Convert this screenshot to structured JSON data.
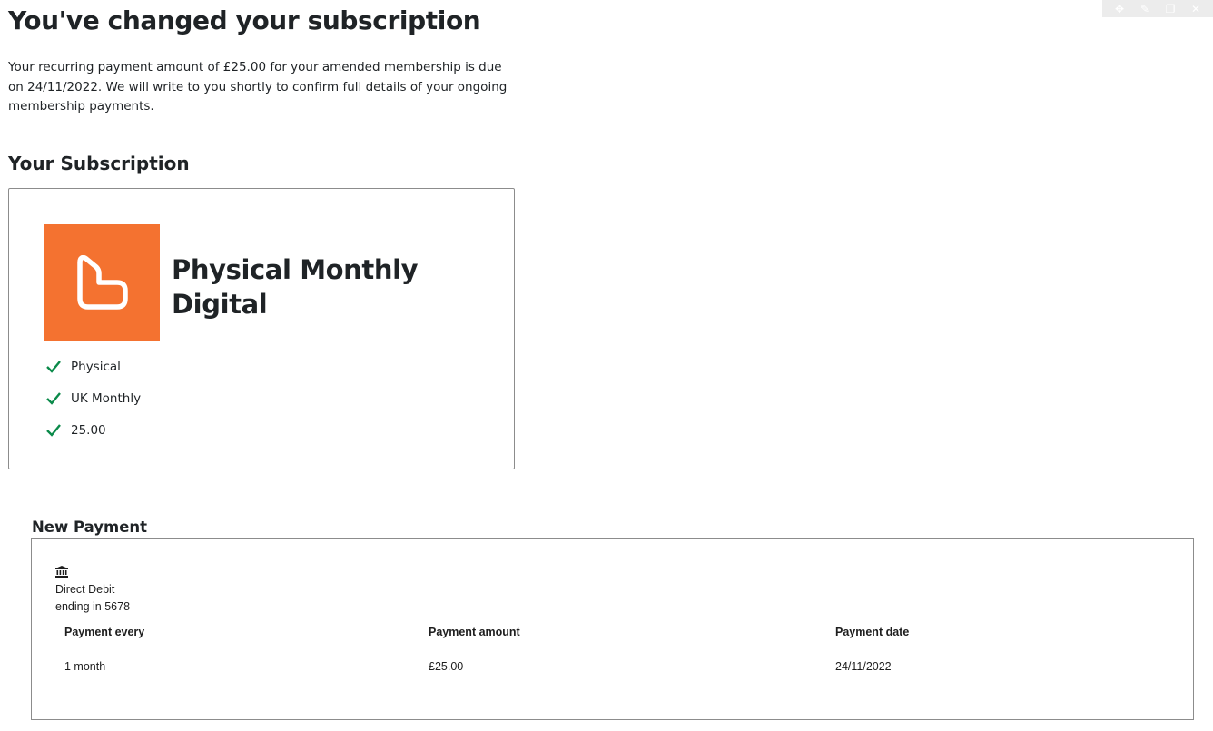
{
  "page": {
    "title": "You've changed your subscription",
    "intro": "Your recurring payment amount of £25.00 for your amended membership is due on 24/11/2022. We will write to you shortly to confirm full details of your ongoing membership payments."
  },
  "subscription": {
    "heading": "Your Subscription",
    "product_name": "Physical Monthly Digital",
    "features": [
      "Physical",
      "UK Monthly",
      "25.00"
    ]
  },
  "payment": {
    "heading": "New Payment",
    "method": "Direct Debit",
    "account_ending": "ending in 5678",
    "columns": [
      {
        "label": "Payment every",
        "value": "1 month"
      },
      {
        "label": "Payment amount",
        "value": "£25.00"
      },
      {
        "label": "Payment date",
        "value": "24/11/2022"
      }
    ]
  },
  "toolbar": {
    "icons": [
      "move-icon",
      "edit-icon",
      "duplicate-icon",
      "close-icon"
    ]
  },
  "colors": {
    "brand_orange": "#f47230",
    "check_green": "#0b8a4a",
    "text": "#1f2326",
    "border": "#8c8c8c"
  }
}
